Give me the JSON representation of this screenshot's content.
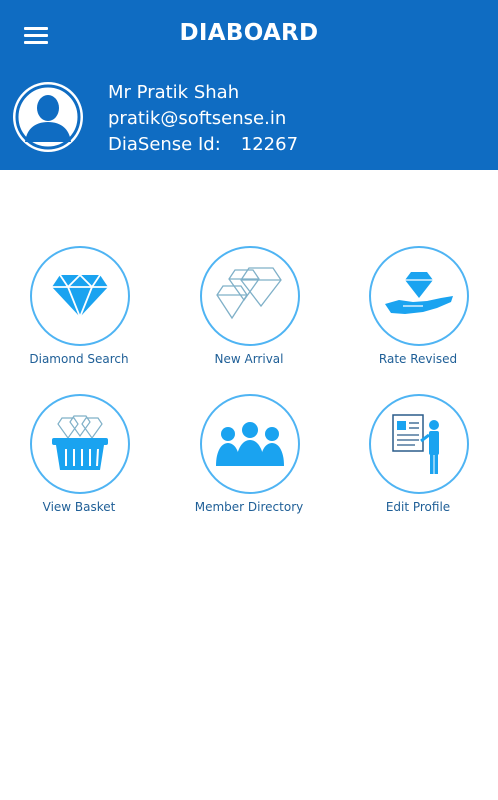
{
  "header": {
    "title": "DIABOARD",
    "menu_icon": "hamburger-menu-icon",
    "bg_color": "#0f6cc2"
  },
  "user": {
    "name": "Mr Pratik Shah",
    "email": "pratik@softsense.in",
    "id_label": "DiaSense Id:",
    "id_value": "12267",
    "avatar_icon": "user-avatar-icon"
  },
  "dashboard": {
    "accent_color": "#4fb4f3",
    "label_color": "#1f5f97",
    "tiles": [
      {
        "label": "Diamond Search",
        "icon": "diamond-icon"
      },
      {
        "label": "New Arrival",
        "icon": "diamonds-group-icon"
      },
      {
        "label": "Rate Revised",
        "icon": "diamond-in-hand-icon"
      },
      {
        "label": "View Basket",
        "icon": "diamond-basket-icon"
      },
      {
        "label": "Member Directory",
        "icon": "members-group-icon"
      },
      {
        "label": "Edit Profile",
        "icon": "edit-profile-icon"
      }
    ]
  }
}
